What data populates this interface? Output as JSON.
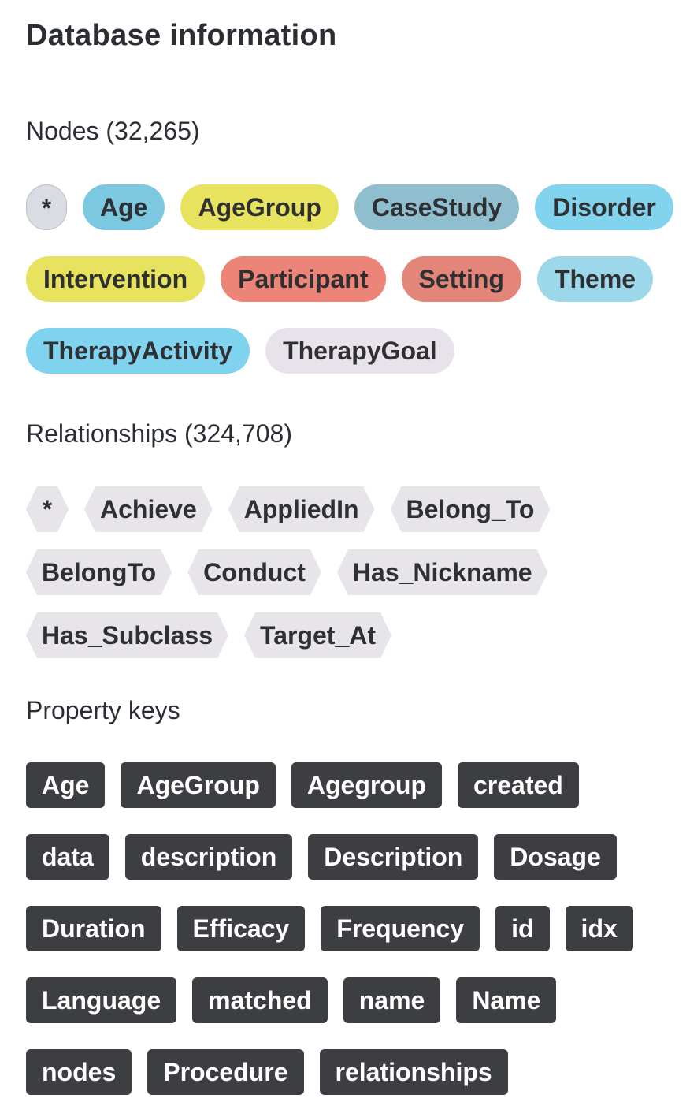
{
  "title": "Database information",
  "nodes": {
    "heading": "Nodes (32,265)",
    "labels": [
      {
        "label": "*",
        "color": "#d9dde3"
      },
      {
        "label": "Age",
        "color": "#7cc8e0"
      },
      {
        "label": "AgeGroup",
        "color": "#e8e35e"
      },
      {
        "label": "CaseStudy",
        "color": "#8fbfcf"
      },
      {
        "label": "Disorder",
        "color": "#82d4ee"
      },
      {
        "label": "Intervention",
        "color": "#e8e35e"
      },
      {
        "label": "Participant",
        "color": "#ec8478"
      },
      {
        "label": "Setting",
        "color": "#e4857a"
      },
      {
        "label": "Theme",
        "color": "#9dd8ea"
      },
      {
        "label": "TherapyActivity",
        "color": "#7fd3ee"
      },
      {
        "label": "TherapyGoal",
        "color": "#e8e2ea"
      }
    ]
  },
  "relationships": {
    "heading": "Relationships (324,708)",
    "types": [
      "*",
      "Achieve",
      "AppliedIn",
      "Belong_To",
      "BelongTo",
      "Conduct",
      "Has_Nickname",
      "Has_Subclass",
      "Target_At"
    ]
  },
  "property_keys": {
    "heading": "Property keys",
    "keys": [
      "Age",
      "AgeGroup",
      "Agegroup",
      "created",
      "data",
      "description",
      "Description",
      "Dosage",
      "Duration",
      "Efficacy",
      "Frequency",
      "id",
      "idx",
      "Language",
      "matched",
      "name",
      "Name",
      "nodes",
      "Procedure",
      "relationships"
    ]
  }
}
